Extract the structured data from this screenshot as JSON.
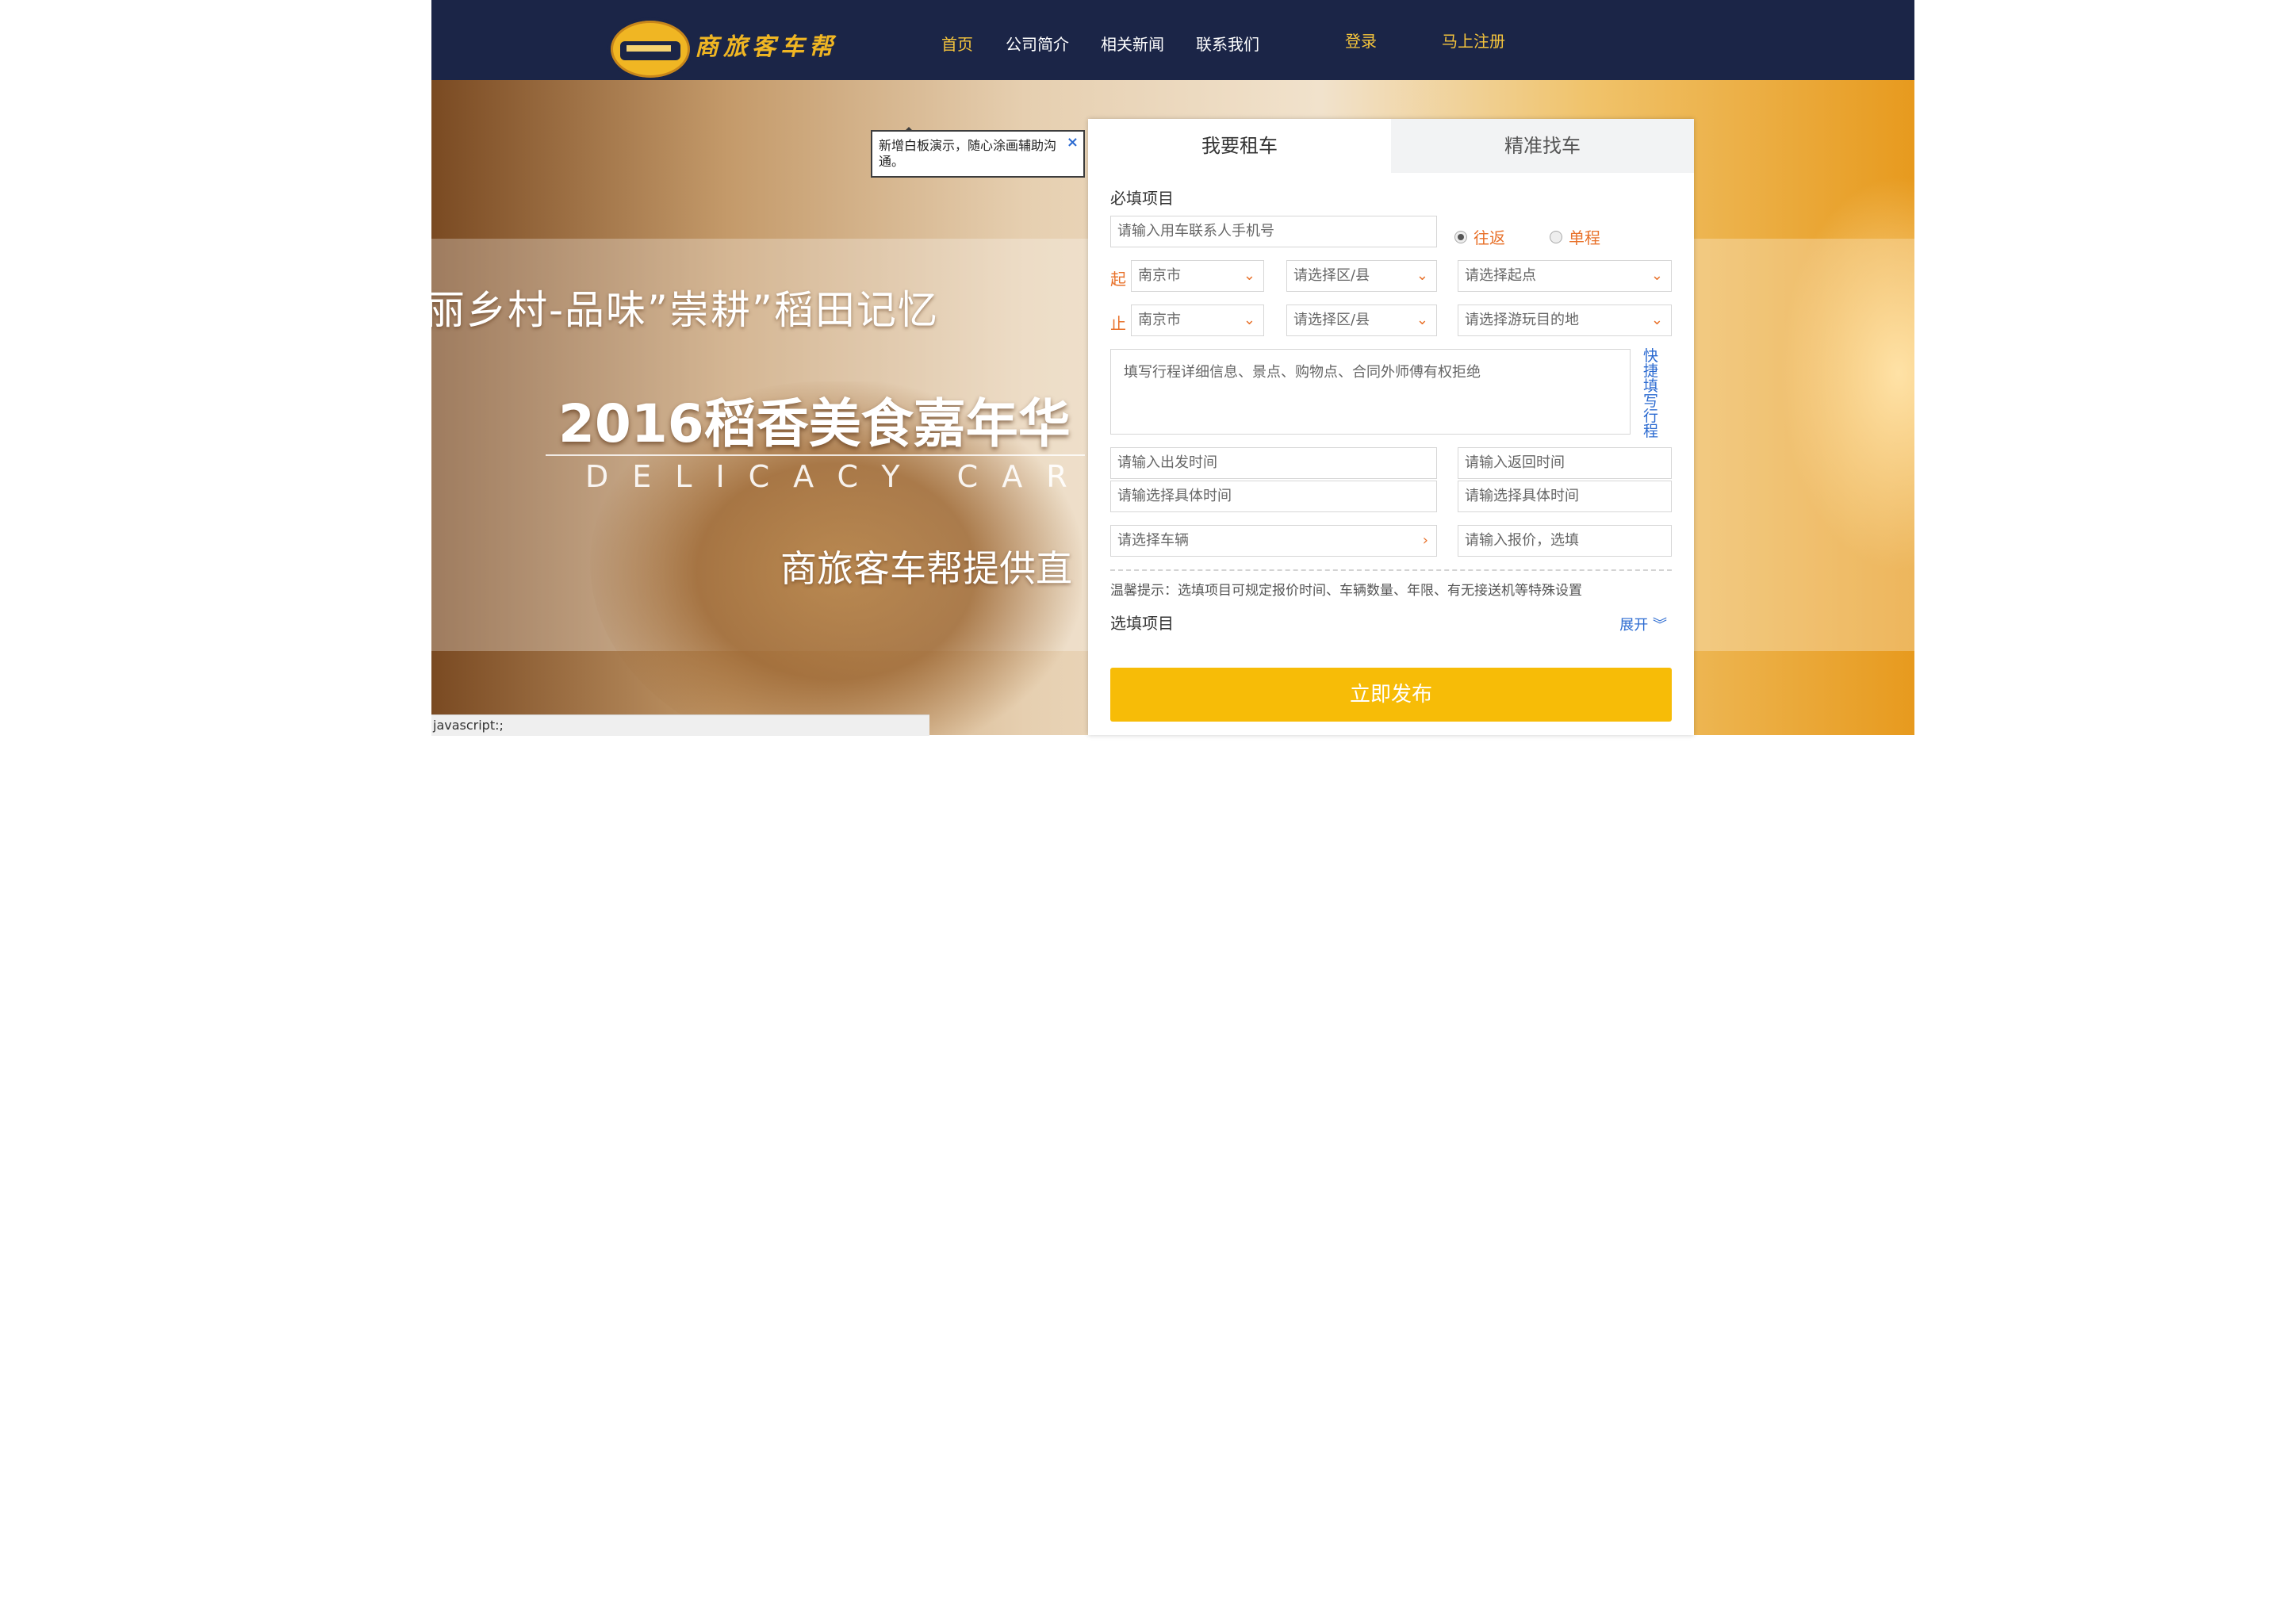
{
  "header": {
    "logo_text": "商旅客车帮",
    "nav": [
      {
        "label": "首页"
      },
      {
        "label": "公司简介"
      },
      {
        "label": "相关新闻"
      },
      {
        "label": "联系我们"
      }
    ],
    "login": "登录",
    "register": "马上注册"
  },
  "hero": {
    "line1": "丽乡村-品味”崇耕”稻田记忆",
    "line2": "2016稻香美食嘉年华",
    "line3": "DELICACY CARNIVAL",
    "line4": "商旅客车帮提供直"
  },
  "status_bar": "javascript:;",
  "tooltip": {
    "text": "新增白板演示，随心涂画辅助沟通。",
    "close": "×"
  },
  "form": {
    "tabs": [
      "我要租车",
      "精准找车"
    ],
    "required_title": "必填项目",
    "phone_placeholder": "请输入用车联系人手机号",
    "trip_type": {
      "round": "往返",
      "single": "单程"
    },
    "start_label": "起",
    "end_label": "止",
    "start_city": "南京市",
    "start_district": "请选择区/县",
    "start_point": "请选择起点",
    "end_city": "南京市",
    "end_district": "请选择区/县",
    "end_point": "请选择游玩目的地",
    "itinerary_placeholder": "填写行程详细信息、景点、购物点、合同外师傅有权拒绝",
    "quick_fill": "快捷填写行程",
    "depart_time": "请输入出发时间",
    "return_time": "请输入返回时间",
    "depart_detail": "请输选择具体时间",
    "return_detail": "请输选择具体时间",
    "vehicle": "请选择车辆",
    "price": "请输入报价，选填",
    "hint": "温馨提示：选填项目可规定报价时间、车辆数量、年限、有无接送机等特殊设置",
    "optional_title": "选填项目",
    "expand": "展开",
    "submit": "立即发布"
  }
}
